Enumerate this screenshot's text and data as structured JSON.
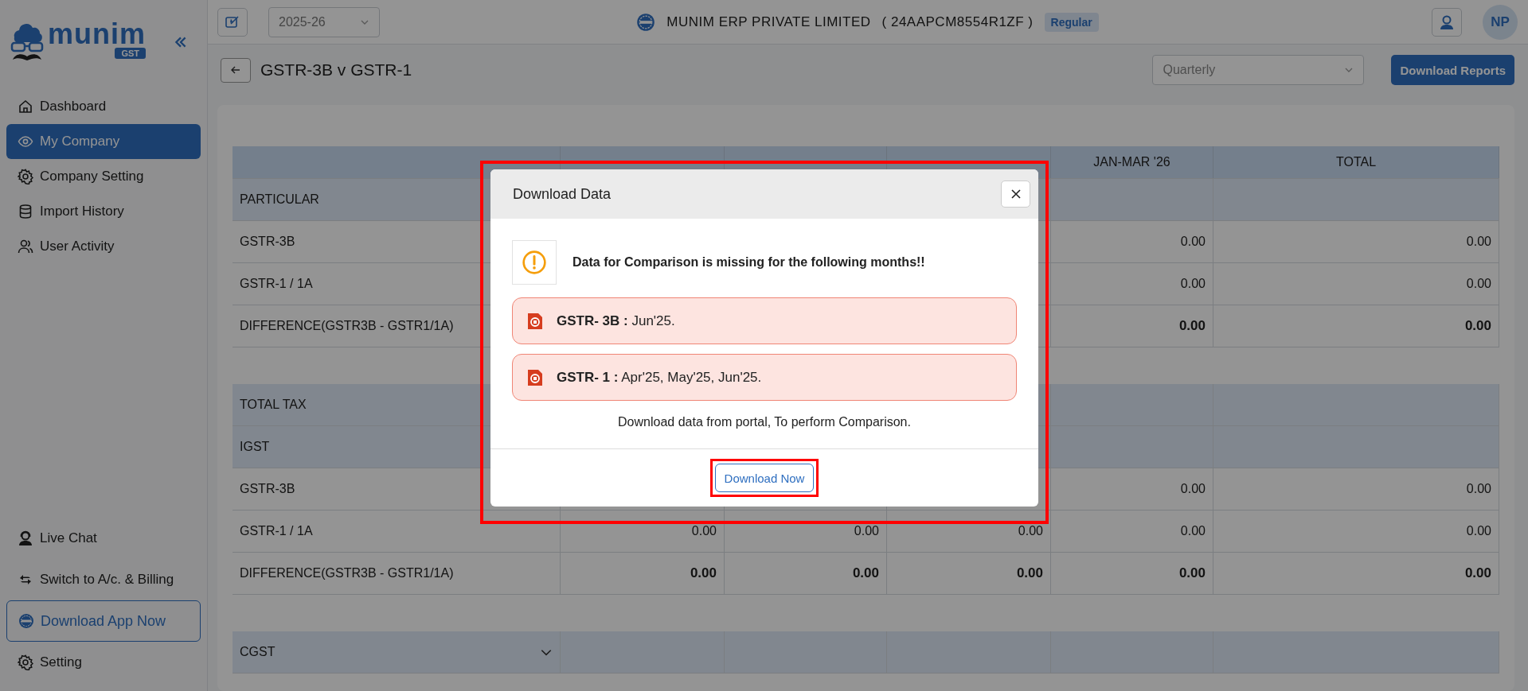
{
  "sidebar": {
    "logo": {
      "wordmark": "munim",
      "badge": "GST"
    },
    "items": [
      {
        "label": "Dashboard",
        "selected": false
      },
      {
        "label": "My Company",
        "selected": true
      },
      {
        "label": "Company Setting",
        "selected": false
      },
      {
        "label": "Import History",
        "selected": false
      },
      {
        "label": "User Activity",
        "selected": false
      }
    ],
    "bottom_items": [
      {
        "label": "Live Chat",
        "kind": "link"
      },
      {
        "label": "Switch to A/c. & Billing",
        "kind": "link"
      },
      {
        "label": "Download App Now",
        "kind": "promo"
      },
      {
        "label": "Setting",
        "kind": "link"
      }
    ]
  },
  "topbar": {
    "year": "2025-26",
    "company": "MUNIM ERP PRIVATE LIMITED",
    "gstin": "( 24AAPCM8554R1ZF )",
    "badge": "Regular",
    "avatar": "NP"
  },
  "page": {
    "title": "GSTR-3B v GSTR-1",
    "period": "Quarterly",
    "download_button": "Download Reports"
  },
  "table": {
    "columns": [
      "JAN-MAR '26",
      "TOTAL"
    ],
    "groups": [
      {
        "rows": [
          {
            "kind": "section",
            "label": "PARTICULAR"
          },
          {
            "kind": "data",
            "label": "GSTR-3B",
            "values": [
              "0.00",
              "0.00"
            ]
          },
          {
            "kind": "data",
            "label": "GSTR-1 / 1A",
            "values": [
              "0.00",
              "0.00"
            ]
          },
          {
            "kind": "total",
            "label": "DIFFERENCE(GSTR3B - GSTR1/1A)",
            "values": [
              "0.00",
              "0.00"
            ]
          }
        ]
      },
      {
        "rows": [
          {
            "kind": "section",
            "label": "TOTAL TAX"
          },
          {
            "kind": "section",
            "label": "IGST"
          },
          {
            "kind": "data",
            "label": "GSTR-3B",
            "values": [
              "0.00",
              "0.00"
            ]
          },
          {
            "kind": "data",
            "label": "GSTR-1 / 1A",
            "values": [
              "0.00",
              "0.00",
              "0.00",
              "0.00",
              "0.00"
            ]
          },
          {
            "kind": "total",
            "label": "DIFFERENCE(GSTR3B - GSTR1/1A)",
            "values": [
              "0.00",
              "0.00",
              "0.00",
              "0.00",
              "0.00"
            ]
          }
        ]
      },
      {
        "rows": [
          {
            "kind": "section",
            "label": "CGST",
            "expanded": false
          }
        ]
      }
    ]
  },
  "modal": {
    "title": "Download Data",
    "highlighted": true,
    "warning": "Data for Comparison is missing for the following months!!",
    "missing": [
      "**GSTR- 3B :** Jun'25.",
      "**GSTR- 1 :** Apr'25, May'25, Jun'25."
    ],
    "note": "Download data from portal, To perform Comparison.",
    "button": {
      "label": "Download Now",
      "highlighted": true
    }
  }
}
